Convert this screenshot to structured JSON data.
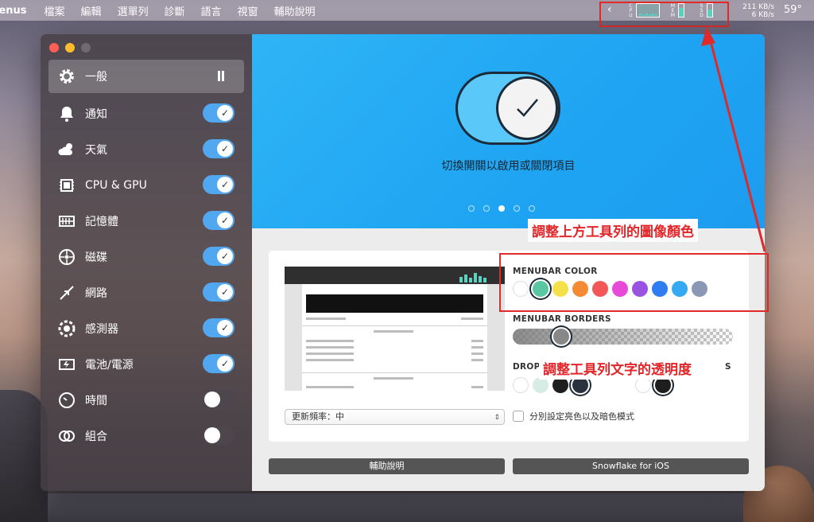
{
  "menubar": {
    "app_name": "lenus",
    "items": [
      "檔案",
      "編輯",
      "選單列",
      "診斷",
      "語言",
      "視窗",
      "輔助說明"
    ],
    "tray": {
      "chevron": "‹",
      "cpu_label": "CPU",
      "mem_label": "MEM",
      "ssd_label": "SSD",
      "net_up": "211 KB/s",
      "net_down": "6 KB/s",
      "temperature": "59°"
    }
  },
  "sidebar": {
    "items": [
      {
        "label": "一般",
        "icon": "gear-icon",
        "state": "paused"
      },
      {
        "label": "通知",
        "icon": "bell-icon",
        "state": "on"
      },
      {
        "label": "天氣",
        "icon": "cloud-sun-icon",
        "state": "on"
      },
      {
        "label": "CPU & GPU",
        "icon": "chip-icon",
        "state": "on"
      },
      {
        "label": "記憶體",
        "icon": "memory-icon",
        "state": "on"
      },
      {
        "label": "磁碟",
        "icon": "disk-icon",
        "state": "on"
      },
      {
        "label": "網路",
        "icon": "network-arrows-icon",
        "state": "on"
      },
      {
        "label": "感測器",
        "icon": "sensor-icon",
        "state": "on"
      },
      {
        "label": "電池/電源",
        "icon": "battery-icon",
        "state": "on"
      },
      {
        "label": "時間",
        "icon": "clock-icon",
        "state": "off"
      },
      {
        "label": "組合",
        "icon": "combine-icon",
        "state": "off"
      }
    ]
  },
  "hero": {
    "caption": "切換開關以啟用或關閉項目",
    "page_count": 5,
    "current_page": 3
  },
  "settings": {
    "menubar_color_label": "MENUBAR COLOR",
    "menubar_colors": [
      "#ffffff",
      "#5ac7a3",
      "#f5e04a",
      "#f58a35",
      "#f25656",
      "#e84ad8",
      "#9a52e0",
      "#2f7df0",
      "#35a9f2",
      "#8a98b6"
    ],
    "menubar_color_selected": 1,
    "menubar_borders_label": "MENUBAR BORDERS",
    "menubar_borders_value": 0.2,
    "drop_label": "DROP",
    "drop_label_tail": "S",
    "drop_colors": [
      "#ffffff",
      "#d8ece6",
      "#1e1e1e",
      "#2a3240"
    ],
    "drop_selected": 3,
    "text_colors": [
      "#ffffff",
      "#1e1e1e"
    ],
    "text_selected": 1,
    "refresh_select": "更新頻率：中",
    "separate_modes_label": "分別設定亮色以及暗色模式"
  },
  "buttons": {
    "help": "輔助說明",
    "ios": "Snowflake for iOS"
  },
  "annotations": {
    "icon_color": "調整上方工具列的圖像顏色",
    "text_opacity": "調整工具列文字的透明度"
  },
  "colors": {
    "accent_blue": "#1ea4f2",
    "toggle_on": "#52a8f0",
    "annotation_red": "#e02a2a"
  }
}
